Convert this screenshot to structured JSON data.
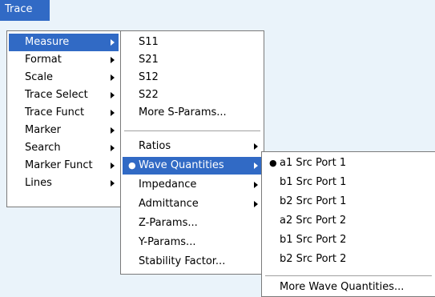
{
  "menubar": {
    "title": "Trace"
  },
  "trace_menu": {
    "items": [
      {
        "label": "Measure"
      },
      {
        "label": "Format"
      },
      {
        "label": "Scale"
      },
      {
        "label": "Trace Select"
      },
      {
        "label": "Trace Funct"
      },
      {
        "label": "Marker"
      },
      {
        "label": "Search"
      },
      {
        "label": "Marker Funct"
      },
      {
        "label": "Lines"
      }
    ]
  },
  "measure_menu": {
    "group1": [
      {
        "label": "S11"
      },
      {
        "label": "S21"
      },
      {
        "label": "S12"
      },
      {
        "label": "S22"
      },
      {
        "label": "More S-Params..."
      }
    ],
    "group2": [
      {
        "label": "Ratios"
      },
      {
        "label": "Wave Quantities"
      },
      {
        "label": "Impedance"
      },
      {
        "label": "Admittance"
      },
      {
        "label": "Z-Params..."
      },
      {
        "label": "Y-Params..."
      },
      {
        "label": "Stability Factor..."
      }
    ]
  },
  "wave_menu": {
    "items": [
      {
        "label": "a1 Src Port 1"
      },
      {
        "label": "b1 Src Port 1"
      },
      {
        "label": "b2 Src Port 1"
      },
      {
        "label": "a2 Src Port 2"
      },
      {
        "label": "b1 Src Port 2"
      },
      {
        "label": "b2 Src Port 2"
      }
    ],
    "more_label": "More Wave Quantities..."
  },
  "bullet_glyph": "●",
  "colors": {
    "highlight": "#316ac5",
    "background": "#eaf3fa",
    "menu_bg": "#ffffff"
  }
}
